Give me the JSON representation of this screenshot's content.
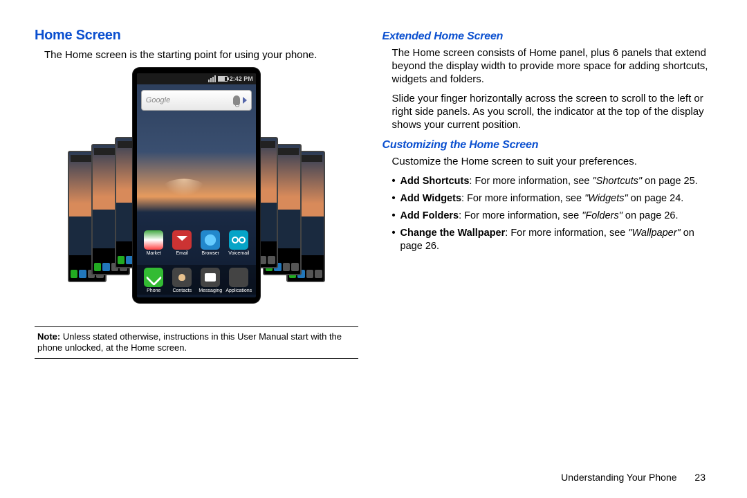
{
  "left": {
    "heading": "Home Screen",
    "intro": "The Home screen is the starting point for using your phone.",
    "note_label": "Note:",
    "note_text": "Unless stated otherwise, instructions in this User Manual start with the phone unlocked, at the Home screen."
  },
  "phone": {
    "time": "2:42 PM",
    "search_placeholder": "Google",
    "row1": [
      {
        "label": "Market"
      },
      {
        "label": "Email"
      },
      {
        "label": "Browser"
      },
      {
        "label": "Voicemail"
      }
    ],
    "dock": [
      {
        "label": "Phone"
      },
      {
        "label": "Contacts"
      },
      {
        "label": "Messaging"
      },
      {
        "label": "Applications"
      }
    ]
  },
  "right": {
    "h_extended": "Extended Home Screen",
    "p_ext1": "The Home screen consists of Home panel, plus 6 panels that extend beyond the display width to provide more space for adding shortcuts, widgets and folders.",
    "p_ext2": "Slide your finger horizontally across the screen to scroll to the left or right side panels. As you scroll, the indicator at the top of the display shows your current position.",
    "h_custom": "Customizing the Home Screen",
    "p_custom": "Customize the Home screen to suit your preferences.",
    "bullets": [
      {
        "bold": "Add Shortcuts",
        "mid": ": For more information, see ",
        "ital": "\"Shortcuts\"",
        "tail": " on page 25."
      },
      {
        "bold": "Add Widgets",
        "mid": ": For more information, see ",
        "ital": "\"Widgets\"",
        "tail": " on page 24."
      },
      {
        "bold": "Add Folders",
        "mid": ": For more information, see ",
        "ital": "\"Folders\"",
        "tail": " on page 26."
      },
      {
        "bold": "Change the Wallpaper",
        "mid": ": For more information, see ",
        "ital": "\"Wallpaper\"",
        "tail": " on page 26."
      }
    ]
  },
  "footer": {
    "section": "Understanding Your Phone",
    "page": "23"
  }
}
